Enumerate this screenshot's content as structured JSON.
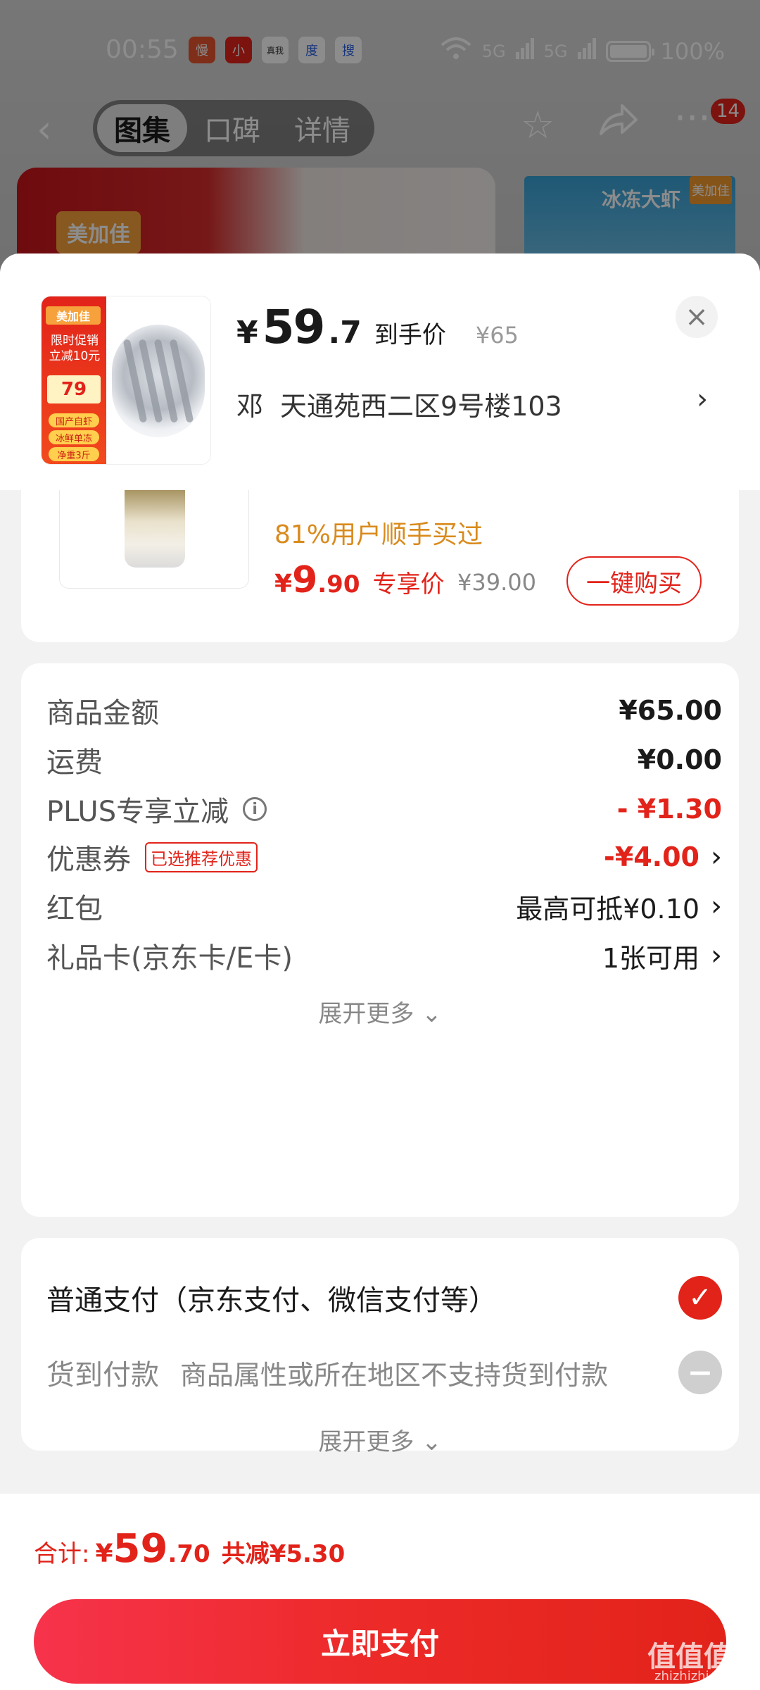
{
  "status_bar": {
    "time": "00:55",
    "apps": [
      "慢",
      "小",
      "真我",
      "度",
      "搜"
    ],
    "signal_1": "5G",
    "signal_2": "5G",
    "battery": "100%"
  },
  "nav": {
    "tabs": [
      "图集",
      "口碑",
      "详情"
    ],
    "active_tab": 0,
    "badge": "14"
  },
  "background": {
    "left_brand": "美加佳",
    "right_title": "冰冻大虾",
    "right_brand": "美加佳"
  },
  "header": {
    "thumb": {
      "brand": "美加佳",
      "promo": "限时促销 立减10元",
      "price": "79",
      "tags": [
        "国产自虾",
        "冰鲜单冻",
        "净重3斤"
      ]
    },
    "price_symbol": "¥",
    "price_int": "59",
    "price_dec": ".7",
    "price_label": "到手价",
    "original_price": "¥65",
    "address_name": "邓",
    "address_text": "天通苑西二区9号楼103"
  },
  "upsell": {
    "percent_text": "81%用户顺手买过",
    "price_symbol": "¥",
    "price_int": "9",
    "price_dec": ".90",
    "price_label": "专享价",
    "original_price": "¥39.00",
    "buy_button": "一键购买"
  },
  "cost": {
    "rows": [
      {
        "label": "商品金额",
        "value": "¥65.00"
      },
      {
        "label": "运费",
        "value": "¥0.00"
      },
      {
        "label": "PLUS专享立减",
        "value": "- ¥1.30"
      },
      {
        "label": "优惠券",
        "tag": "已选推荐优惠",
        "value": "-¥4.00"
      },
      {
        "label": "红包",
        "value": "最高可抵¥0.10"
      },
      {
        "label": "礼品卡(京东卡/E卡)",
        "value": "1张可用"
      }
    ],
    "expand": "展开更多"
  },
  "payment": {
    "normal": "普通支付（京东支付、微信支付等）",
    "cod_label": "货到付款",
    "cod_note": "商品属性或所在地区不支持货到付款",
    "expand": "展开更多"
  },
  "footer": {
    "total_label": "合计:",
    "total_symbol": "¥",
    "total_int": "59",
    "total_dec": ".70",
    "savings": "共减¥5.30",
    "pay_button": "立即支付"
  },
  "watermark": {
    "main": "值值值",
    "sub": "zhizhizhi.com"
  },
  "colors": {
    "accent_red": "#e2231a",
    "orange_text": "#d98a1c"
  }
}
